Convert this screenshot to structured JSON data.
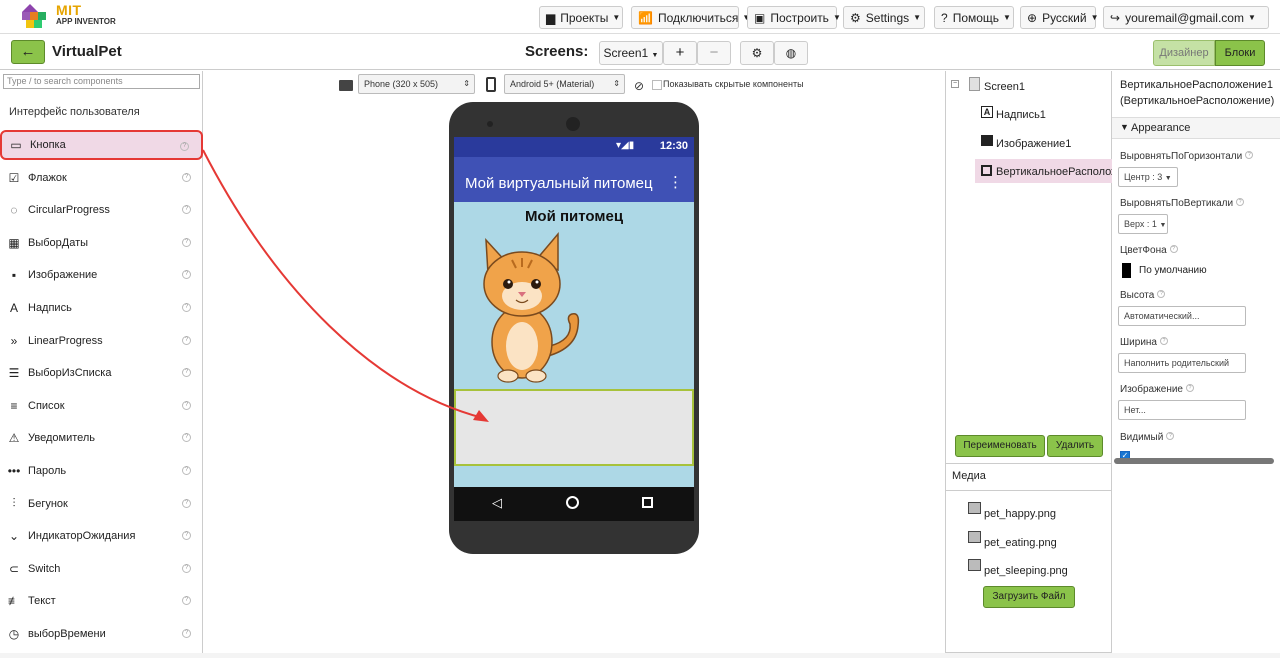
{
  "header": {
    "logo_top": "MIT",
    "logo_bottom": "APP INVENTOR",
    "menus": [
      {
        "label": "Проекты",
        "icon": "folder-icon"
      },
      {
        "label": "Подключиться",
        "icon": "phone-connect-icon"
      },
      {
        "label": "Построить",
        "icon": "build-icon"
      },
      {
        "label": "Settings",
        "icon": "gear-icon"
      },
      {
        "label": "Помощь",
        "icon": "help-icon"
      },
      {
        "label": "Русский",
        "icon": "globe-icon"
      },
      {
        "label": "youremail@gmail.com",
        "icon": "logout-icon"
      }
    ]
  },
  "project": {
    "back_label": "←",
    "title": "VirtualPet",
    "screens_label": "Screens:",
    "screen_select": "Screen1",
    "add_label": "+",
    "remove_label": "−",
    "designer_label": "Дизайнер",
    "blocks_label": "Блоки"
  },
  "palette": {
    "search_placeholder": "Type / to search components",
    "section": "Интерфейс пользователя",
    "items": [
      {
        "label": "Кнопка",
        "icon": "button-icon",
        "glyph": "▭"
      },
      {
        "label": "Флажок",
        "icon": "checkbox-icon",
        "glyph": "☑"
      },
      {
        "label": "CircularProgress",
        "icon": "circular-progress-icon",
        "glyph": "◌"
      },
      {
        "label": "ВыборДаты",
        "icon": "calendar-icon",
        "glyph": "▦"
      },
      {
        "label": "Изображение",
        "icon": "image-icon",
        "glyph": "▪"
      },
      {
        "label": "Надпись",
        "icon": "label-icon",
        "glyph": "A"
      },
      {
        "label": "LinearProgress",
        "icon": "linear-progress-icon",
        "glyph": "»"
      },
      {
        "label": "ВыборИзСписка",
        "icon": "listpicker-icon",
        "glyph": "☰"
      },
      {
        "label": "Список",
        "icon": "listview-icon",
        "glyph": "≡"
      },
      {
        "label": "Уведомитель",
        "icon": "warning-icon",
        "glyph": "⚠"
      },
      {
        "label": "Пароль",
        "icon": "password-icon",
        "glyph": "•••"
      },
      {
        "label": "Бегунок",
        "icon": "slider-icon",
        "glyph": "⫶"
      },
      {
        "label": "ИндикаторОжидания",
        "icon": "spinner-icon",
        "glyph": "⌄"
      },
      {
        "label": "Switch",
        "icon": "switch-icon",
        "glyph": "⊂"
      },
      {
        "label": "Текст",
        "icon": "textbox-icon",
        "glyph": "≢"
      },
      {
        "label": "выборВремени",
        "icon": "clock-icon",
        "glyph": "◷"
      }
    ],
    "help_glyph": "?"
  },
  "viewer": {
    "phone_size": "Phone (320 x 505)",
    "theme": "Android 5+ (Material)",
    "show_hidden": "Показывать скрытые компоненты",
    "status_time": "12:30",
    "app_title": "Мой виртуальный питомец",
    "menu_dots": "⋮",
    "pet_title": "Мой питомец"
  },
  "components": {
    "root": "Screen1",
    "children": [
      "Надпись1",
      "Изображение1",
      "ВертикальноеРасположение1"
    ],
    "rename_label": "Переименовать",
    "delete_label": "Удалить"
  },
  "media": {
    "title": "Медиа",
    "files": [
      "pet_happy.png",
      "pet_eating.png",
      "pet_sleeping.png"
    ],
    "upload_label": "Загрузить Файл"
  },
  "properties": {
    "component": "ВертикальноеРасположение1",
    "component_type": "(ВертикальноеРасположение)",
    "section": "Appearance",
    "align_h_label": "ВыровнятьПоГоризонтали",
    "align_h_value": "Центр : 3",
    "align_v_label": "ВыровнятьПоВертикали",
    "align_v_value": "Верх : 1",
    "bg_label": "ЦветФона",
    "bg_value": "По умолчанию",
    "height_label": "Высота",
    "height_value": "Автоматический...",
    "width_label": "Ширина",
    "width_value": "Наполнить родительский",
    "image_label": "Изображение",
    "image_value": "Нет...",
    "visible_label": "Видимый",
    "visible_checked": true
  },
  "colors": {
    "green": "#8bc34a",
    "selected_pink": "#f0d9e6",
    "arrow_red": "#e53935",
    "appbar": "#3f51b5",
    "screen_bg": "#add8e6"
  }
}
